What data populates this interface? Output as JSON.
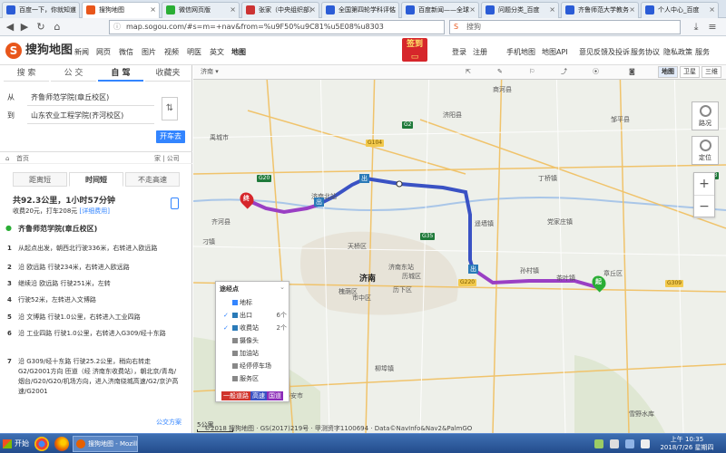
{
  "browser": {
    "tabs": [
      {
        "label": "百度一下，你就知道",
        "color": "#2b5cd6"
      },
      {
        "label": "搜狗地图",
        "color": "#e8561b",
        "active": true
      },
      {
        "label": "微信网页版",
        "color": "#2aae35"
      },
      {
        "label": "张家（中央组织部）",
        "color": "#c33"
      },
      {
        "label": "全国第四轮学科评估",
        "color": "#2b5cd6"
      },
      {
        "label": "百度新闻——全球",
        "color": "#2b5cd6"
      },
      {
        "label": "问题分类_百度",
        "color": "#2b5cd6"
      },
      {
        "label": "齐鲁师范大学教务",
        "color": "#2b5cd6"
      },
      {
        "label": "个人中心_百度",
        "color": "#2b5cd6"
      }
    ],
    "url": "map.sogou.com/#s=m=+nav&from=%u9F50%u9C81%u5E08%u8303",
    "search_placeholder": "搜狗"
  },
  "site": {
    "logo": "搜狗地图",
    "logo_mark": "S",
    "nav": [
      "新闻",
      "网页",
      "微信",
      "图片",
      "视频",
      "明医",
      "英文",
      "地图"
    ],
    "signin_badge": "签到",
    "login": "登录",
    "register": "注册",
    "right_links": [
      "手机地图",
      "地图API",
      "意见反馈及投诉",
      "服务协议",
      "隐私政策",
      "服务"
    ]
  },
  "panel": {
    "modes": [
      "搜 索",
      "公 交",
      "自 驾",
      "收藏夹"
    ],
    "active_mode": 2,
    "from_label": "从",
    "from_value": "齐鲁师范学院(章丘校区)",
    "to_label": "到",
    "to_value": "山东农业工程学院(齐河校区)",
    "go_button": "开车去",
    "breadcrumb_home": "首页",
    "breadcrumb_right": "家 | 公司",
    "route_tabs": [
      "距离短",
      "时间短",
      "不走高速"
    ],
    "active_route_tab": 1,
    "summary": "共92.3公里，1小时57分钟",
    "fee_text": "收费20元，打车208元",
    "fee_link": "[详细费用]",
    "start_point": "齐鲁师范学院(章丘校区)",
    "steps": [
      {
        "n": "1",
        "text": "从起点出发，朝西北行驶336米，右转进入欧远路"
      },
      {
        "n": "2",
        "text": "沿 欧远路 行驶234米，右转进入欧远路"
      },
      {
        "n": "3",
        "text": "继续沿 欧远路 行驶251米，左转"
      },
      {
        "n": "4",
        "text": "行驶52米，左转进入文博路"
      },
      {
        "n": "5",
        "text": "沿 文博路 行驶1.0公里，右转进入工业四路"
      },
      {
        "n": "6",
        "text": "沿 工业四路 行驶1.0公里，右转进入G309/经十东路"
      },
      {
        "n": "7",
        "text": "沿 G309/经十东路 行驶25.2公里，稍向右转走G2/G2001方向 匝道（经 济南东收费站），朝北京/青岛/烟台/G20/G20/机场方向，进入济南绕城高速/G2/京沪高速/G2001"
      }
    ],
    "bus_plan": "公交方案"
  },
  "map": {
    "toolbar": {
      "region": "济南",
      "types": [
        "地图",
        "卫星",
        "三维"
      ],
      "active_type": 0
    },
    "right_buttons": [
      {
        "label": "路况"
      },
      {
        "label": "定位"
      }
    ],
    "zoom_in": "+",
    "zoom_out": "−",
    "labels": {
      "city": "济南",
      "places": [
        "齐河县",
        "禹城市",
        "济阳县",
        "商河县",
        "邹平县",
        "章丘区",
        "长清区",
        "平阴县",
        "泰安市",
        "历城区",
        "历下区",
        "市中区",
        "槐荫区",
        "天桥区",
        "济南北站",
        "济南东站",
        "丁桥镇",
        "孙村镇",
        "雪野水库",
        "遥墙镇",
        "党家庄镇",
        "茶叶镇",
        "刁镇",
        "柳埠镇"
      ],
      "shields": [
        "G20",
        "G2",
        "G104",
        "G35",
        "G309",
        "G220",
        "G3"
      ]
    },
    "markers": {
      "start": "起",
      "end": "终"
    },
    "route_badge": "出",
    "legend": {
      "title": "途经点",
      "items": [
        {
          "label": "地标",
          "count": "",
          "checked": false,
          "color": "#3385ff"
        },
        {
          "label": "出口",
          "count": "6个",
          "checked": true,
          "color": "#2a7ab8"
        },
        {
          "label": "收费站",
          "count": "2个",
          "checked": true,
          "color": "#2a7ab8"
        },
        {
          "label": "摄像头",
          "count": "",
          "checked": false,
          "color": "#888"
        },
        {
          "label": "加油站",
          "count": "",
          "checked": false,
          "color": "#888"
        },
        {
          "label": "经停停车场",
          "count": "",
          "checked": false,
          "color": "#888"
        },
        {
          "label": "服务区",
          "count": "",
          "checked": false,
          "color": "#888"
        }
      ],
      "road_key": [
        {
          "label": "一般道路",
          "color": "#d0342c"
        },
        {
          "label": "高速",
          "color": "#3a52c4"
        },
        {
          "label": "国道",
          "color": "#8c2bb8"
        }
      ]
    },
    "scale": "5公里",
    "copyright": "©2018 搜狗地图 · GS(2017)219号 · 甲测资字1100694 · Data©NavInfo&Nav2&PalmGO",
    "route_colors": {
      "highway": "#3a52c4",
      "national": "#9a3fc4"
    }
  },
  "taskbar": {
    "start": "开始",
    "task_label": "搜狗地图 - Mozilla...",
    "time": "上午 10:35",
    "date": "2018/7/26 星期四"
  }
}
